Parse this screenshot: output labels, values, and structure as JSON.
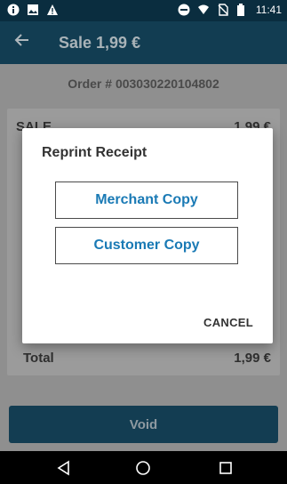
{
  "status_bar": {
    "time": "11:41",
    "left_icons": [
      "info-icon",
      "image-icon",
      "warning-icon"
    ],
    "right_icons": [
      "do-not-disturb-icon",
      "wifi-icon",
      "no-sim-icon",
      "battery-icon"
    ]
  },
  "app_bar": {
    "title": "Sale 1,99 €"
  },
  "order": {
    "label": "Order # 003030220104802"
  },
  "summary": {
    "sale_label": "SALE",
    "sale_amount": "1,99 €",
    "total_label": "Total",
    "total_amount": "1,99 €"
  },
  "void_button": {
    "label": "Void"
  },
  "dialog": {
    "title": "Reprint Receipt",
    "merchant_copy": "Merchant Copy",
    "customer_copy": "Customer Copy",
    "cancel": "CANCEL"
  },
  "colors": {
    "accent": "#1a7ab5",
    "appbar": "#123d52",
    "status": "#0a2d3f"
  }
}
